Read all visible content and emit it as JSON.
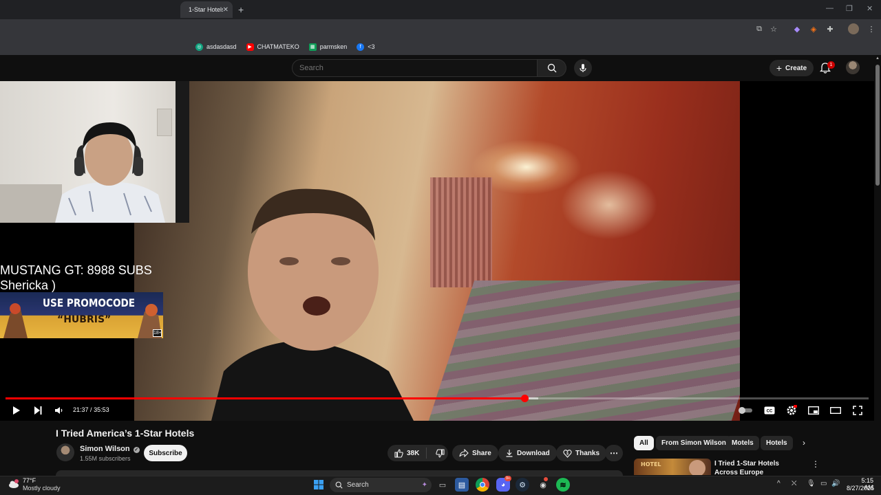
{
  "browser": {
    "tab_title": "1-Star Hotels",
    "tab_close": "✕",
    "new_tab": "+",
    "bookmarks": [
      {
        "label": "asdasdasd",
        "icon": "gpt-icon",
        "color": "#10a37f"
      },
      {
        "label": "CHATMATEKO",
        "icon": "youtube-icon",
        "color": "#ff0000"
      },
      {
        "label": "parmsken",
        "icon": "sheets-icon",
        "color": "#0f9d58"
      },
      {
        "label": "<3",
        "icon": "facebook-icon",
        "color": "#1877f2"
      }
    ]
  },
  "youtube": {
    "search_placeholder": "Search",
    "create_label": "Create",
    "notification_count": "1"
  },
  "player": {
    "current_time": "21:37",
    "separator": "/",
    "duration": "35:53",
    "progress_fraction": 0.602,
    "buffer_fraction": 0.617
  },
  "overlay": {
    "goal_text": "MUSTANG GT: 8988 SUBS",
    "donor_text": "Shericka )",
    "promo_line1": "USE PROMOCODE",
    "promo_line2": "“HUBRIS”",
    "age_rating": "18+"
  },
  "video": {
    "title": "I Tried America’s 1-Star Hotels",
    "channel": "Simon Wilson",
    "subscribers": "1.55M subscribers",
    "subscribe_label": "Subscribe",
    "likes": "38K",
    "share_label": "Share",
    "download_label": "Download",
    "thanks_label": "Thanks"
  },
  "sidebar": {
    "chips": [
      "All",
      "From Simon Wilson",
      "Motels",
      "Hotels"
    ],
    "rec_title": "I Tried 1-Star Hotels Across Europe",
    "rec_thumb_text": "HOTEL"
  },
  "taskbar": {
    "temperature": "77°F",
    "weather": "Mostly cloudy",
    "search_label": "Search",
    "time": "5:15 AM",
    "date": "8/27/2025",
    "discord_badge": "9+"
  }
}
